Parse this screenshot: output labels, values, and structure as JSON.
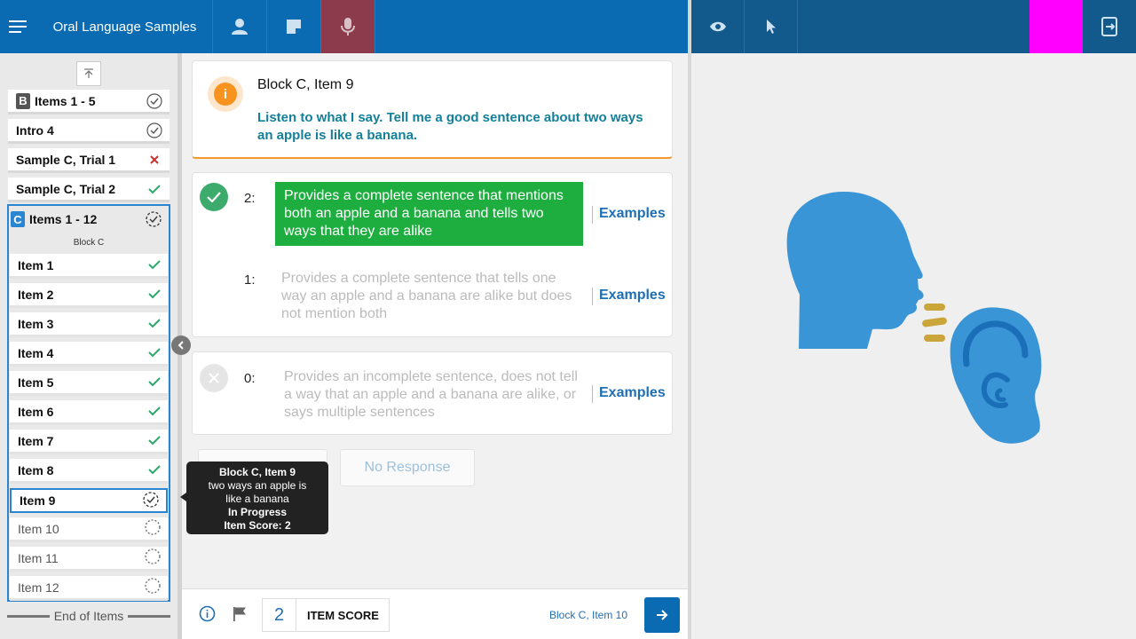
{
  "app": {
    "title": "Oral Language Samples"
  },
  "sidebar": {
    "top_rows": [
      {
        "badge": "B",
        "label": "Items 1 - 5",
        "status": "complete"
      },
      {
        "label": "Intro 4",
        "status": "complete"
      },
      {
        "label": "Sample C, Trial 1",
        "status": "incorrect"
      },
      {
        "label": "Sample C, Trial 2",
        "status": "correct"
      }
    ],
    "block_c": {
      "badge": "C",
      "label": "Items 1 - 12",
      "sub_label": "Block C",
      "items": [
        {
          "label": "Item 1",
          "status": "correct"
        },
        {
          "label": "Item 2",
          "status": "correct"
        },
        {
          "label": "Item 3",
          "status": "correct"
        },
        {
          "label": "Item 4",
          "status": "correct"
        },
        {
          "label": "Item 5",
          "status": "correct"
        },
        {
          "label": "Item 6",
          "status": "correct"
        },
        {
          "label": "Item 7",
          "status": "correct"
        },
        {
          "label": "Item 8",
          "status": "correct"
        },
        {
          "label": "Item 9",
          "status": "in-progress"
        },
        {
          "label": "Item 10",
          "status": "not-started"
        },
        {
          "label": "Item 11",
          "status": "not-started"
        },
        {
          "label": "Item 12",
          "status": "not-started"
        }
      ]
    },
    "end_label": "End of Items"
  },
  "question": {
    "title": "Block C, Item 9",
    "prompt": "Listen to what I say. Tell me a good sentence about two ways an apple is like a banana."
  },
  "scores": [
    {
      "score": "2:",
      "description": "Provides a complete sentence that mentions both an apple and a banana and tells two ways that they are alike",
      "examples": "Examples",
      "selected": true
    },
    {
      "score": "1:",
      "description": "Provides a complete sentence that tells one way an apple and a banana are alike but does not mention both",
      "examples": "Examples",
      "selected": false
    },
    {
      "score": "0:",
      "description": "Provides an incomplete sentence, does not tell a way that an apple and a banana are alike, or says multiple sentences",
      "examples": "Examples",
      "selected": false
    }
  ],
  "no_response_label": "No Response",
  "tooltip": {
    "title": "Block C, Item 9",
    "line": "two ways an apple is like a banana",
    "status": "In Progress",
    "score": "Item Score: 2"
  },
  "footer": {
    "score_value": "2",
    "score_label": "ITEM SCORE",
    "next_label": "Block C, Item 10"
  },
  "colors": {
    "topbar": "#0a6bb3",
    "topbar_right": "#125a8c",
    "active_tab": "#8c3b4d",
    "selected_score": "#1dae3f",
    "accent_orange": "#f7931e",
    "prompt_teal": "#137f9a",
    "link_blue": "#1f6fb4",
    "illustration_blue": "#3a95d6",
    "illustration_gold": "#c9a53a",
    "magenta": "#ff00ff"
  }
}
